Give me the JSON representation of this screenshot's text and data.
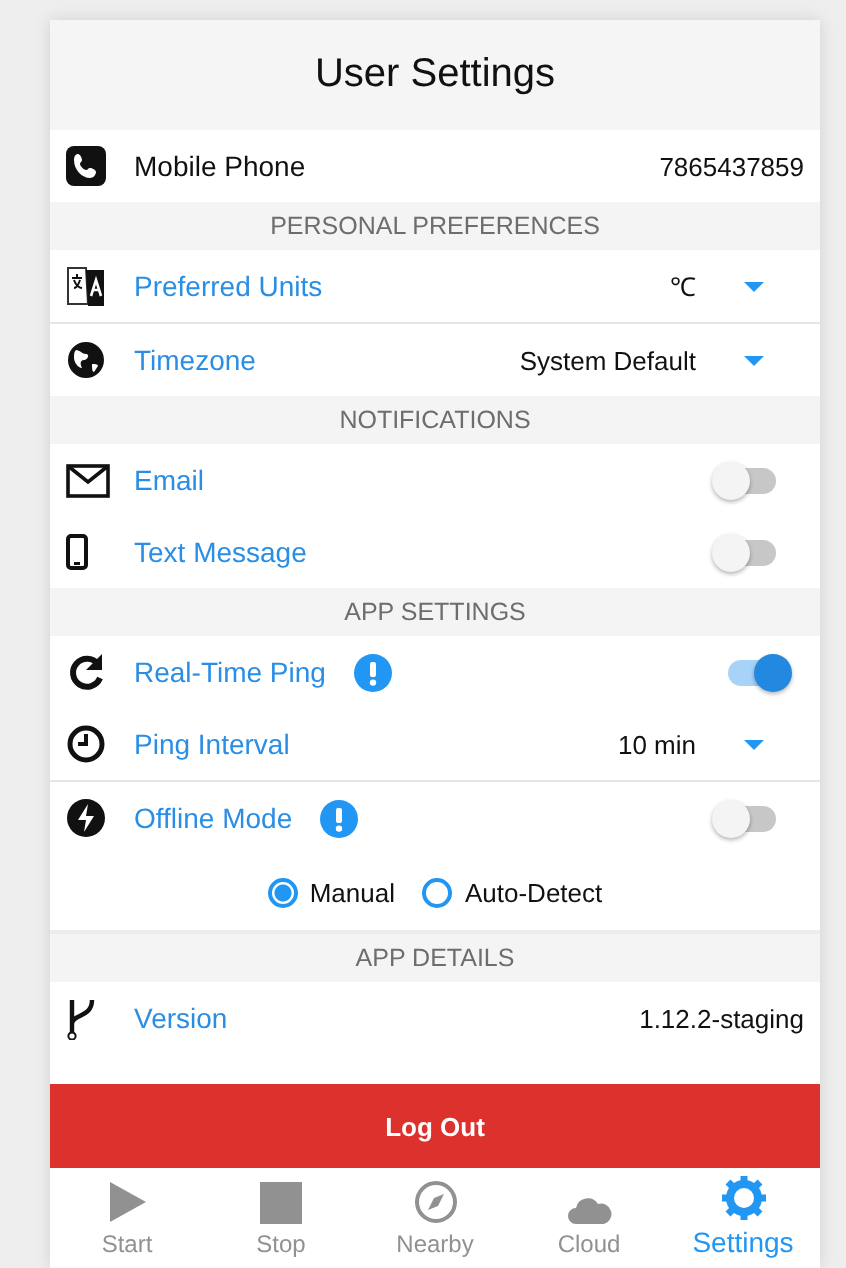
{
  "title": "User Settings",
  "sections": [
    {
      "rows": [
        {
          "kind": "contact",
          "label": "Mobile Phone",
          "value": "7865437859"
        }
      ]
    },
    {
      "header": "PERSONAL PREFERENCES",
      "rows": [
        {
          "kind": "select",
          "label": "Preferred Units",
          "value": "℃"
        },
        {
          "kind": "select",
          "label": "Timezone",
          "value": "System Default"
        }
      ]
    },
    {
      "header": "NOTIFICATIONS",
      "rows": [
        {
          "kind": "toggle",
          "label": "Email",
          "on": false
        },
        {
          "kind": "toggle",
          "label": "Text Message",
          "on": false
        }
      ]
    },
    {
      "header": "APP SETTINGS",
      "rows": [
        {
          "kind": "toggle",
          "label": "Real-Time Ping",
          "on": true,
          "info": true
        },
        {
          "kind": "select",
          "label": "Ping Interval",
          "value": "10 min",
          "info": false
        },
        {
          "kind": "toggle",
          "label": "Offline Mode",
          "on": false,
          "info": true
        },
        {
          "kind": "radio",
          "options": [
            {
              "label": "Manual",
              "selected": true
            },
            {
              "label": "Auto-Detect",
              "selected": false
            }
          ]
        }
      ]
    },
    {
      "header": "APP DETAILS",
      "rows": [
        {
          "kind": "value",
          "label": "Version",
          "value": "1.12.2-staging"
        }
      ]
    }
  ],
  "logout": "Log Out",
  "tabs": [
    {
      "label": "Start",
      "selected": false
    },
    {
      "label": "Stop",
      "selected": false
    },
    {
      "label": "Nearby",
      "selected": false
    },
    {
      "label": "Cloud",
      "selected": false
    },
    {
      "label": "Settings",
      "selected": true
    }
  ]
}
